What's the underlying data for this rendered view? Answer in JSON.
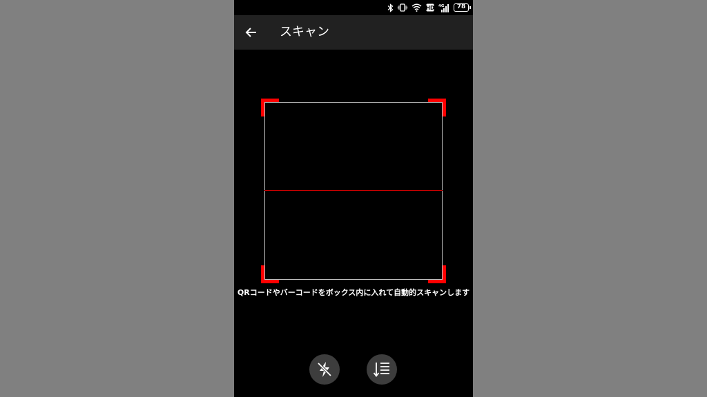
{
  "status_bar": {
    "battery_level": "78",
    "network_type": "4G",
    "hd_label": "HD",
    "icons": [
      "bluetooth-icon",
      "vibrate-icon",
      "wifi-icon",
      "hd-icon",
      "signal-icon",
      "battery-icon"
    ]
  },
  "app_bar": {
    "title": "スキャン",
    "back_icon": "arrow-left-icon"
  },
  "scanner": {
    "hint": "QRコードやバーコードをボックス内に入れて自動的スキャンします",
    "frame_color": "#ff0000",
    "scan_line_color": "#d00000"
  },
  "actions": [
    {
      "name": "flash-off-button",
      "icon": "flash-off-icon"
    },
    {
      "name": "history-button",
      "icon": "sort-list-icon"
    }
  ],
  "colors": {
    "background": "#000000",
    "app_bar": "#212121",
    "outer": "#808080",
    "fab": "#3d3d3d"
  }
}
